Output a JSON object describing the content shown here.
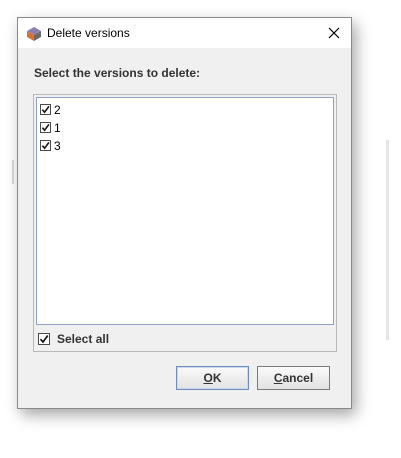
{
  "window": {
    "title": "Delete versions"
  },
  "prompt": "Select the versions to delete:",
  "versions": [
    {
      "label": "2",
      "checked": true
    },
    {
      "label": "1",
      "checked": true
    },
    {
      "label": "3",
      "checked": true
    }
  ],
  "select_all": {
    "label": "Select all",
    "checked": true
  },
  "buttons": {
    "ok_mnemonic": "O",
    "ok_rest": "K",
    "cancel_mnemonic": "C",
    "cancel_rest": "ancel"
  },
  "icons": {
    "app": "app-logo-icon",
    "close": "close-icon",
    "check": "checkmark-icon"
  }
}
